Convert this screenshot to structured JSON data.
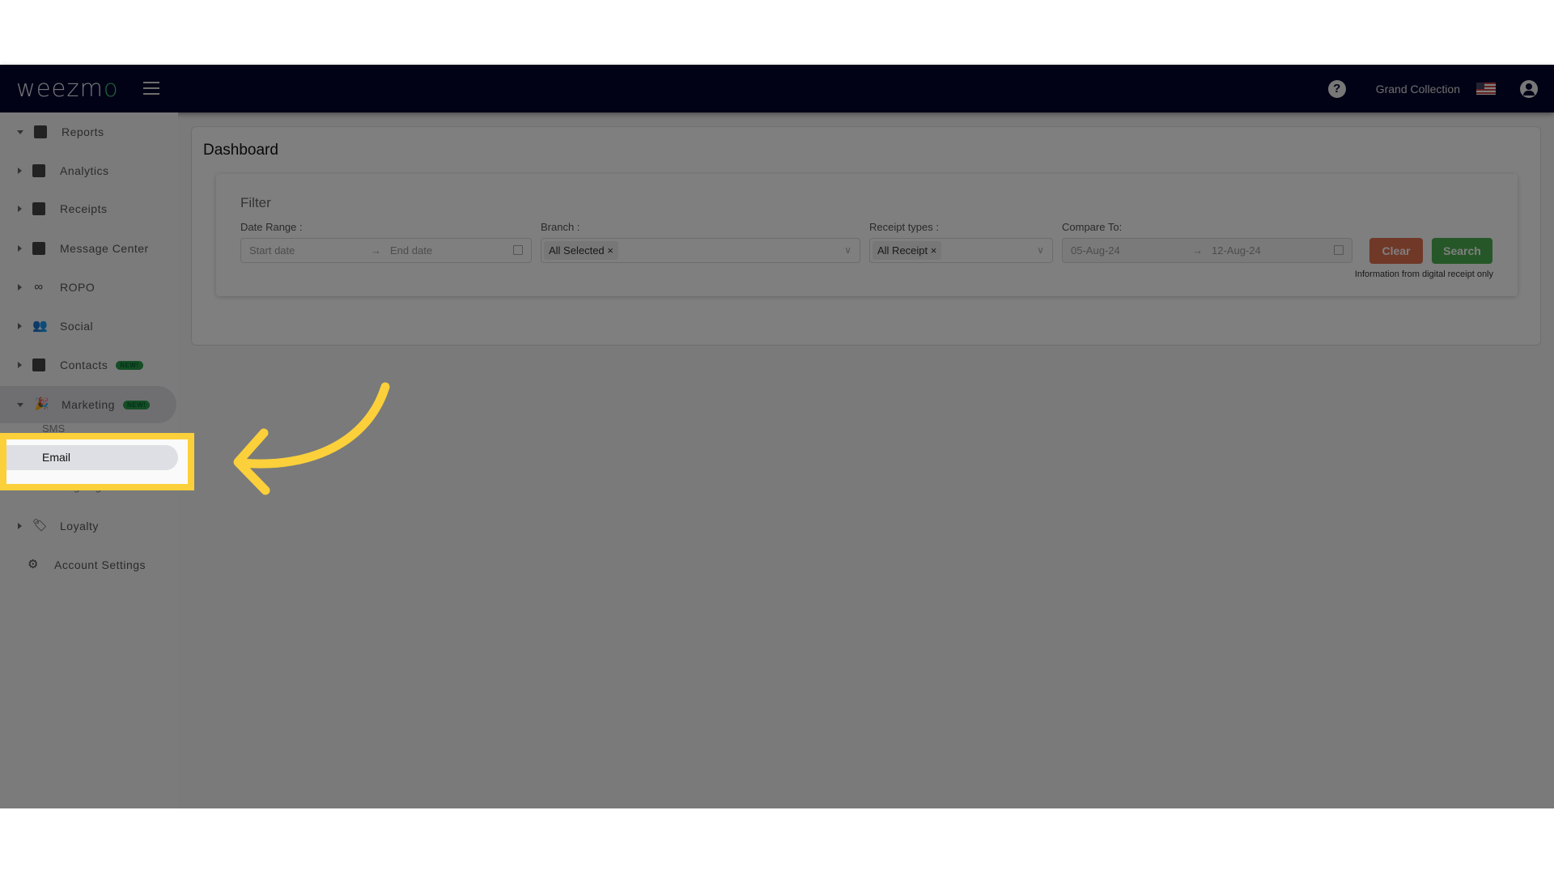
{
  "header": {
    "logo": "weezmo",
    "account": "Grand Collection",
    "icons": [
      "menu-icon",
      "help-icon",
      "us-flag-icon",
      "user-icon"
    ]
  },
  "sidebar": {
    "items": [
      {
        "label": "Reports",
        "icon": "dashboard-icon",
        "expanded": true
      },
      {
        "label": "Analytics",
        "icon": "chart-icon"
      },
      {
        "label": "Receipts",
        "icon": "receipt-icon"
      },
      {
        "label": "Message Center",
        "icon": "chat-icon"
      },
      {
        "label": "ROPO",
        "icon": "infinity-icon"
      },
      {
        "label": "Social",
        "icon": "people-icon"
      },
      {
        "label": "Contacts",
        "icon": "contacts-icon",
        "badge": "NEW!"
      },
      {
        "label": "Marketing",
        "icon": "party-icon",
        "badge": "NEW!",
        "expanded": true
      },
      {
        "label": "Loyalty",
        "icon": "tag-icon"
      },
      {
        "label": "Account Settings",
        "icon": "gear-icon"
      }
    ],
    "marketing_sub": [
      "SMS",
      "Email",
      "Landing Pages"
    ]
  },
  "main": {
    "title": "Dashboard",
    "filter": {
      "title": "Filter",
      "date_range": {
        "label": "Date Range :",
        "start_placeholder": "Start date",
        "end_placeholder": "End date"
      },
      "branch": {
        "label": "Branch :",
        "value": "All Selected"
      },
      "receipt_types": {
        "label": "Receipt types :",
        "value": "All Receipt"
      },
      "compare_to": {
        "label": "Compare To:",
        "start": "05-Aug-24",
        "end": "12-Aug-24"
      },
      "clear_label": "Clear",
      "search_label": "Search",
      "info": "Information from digital receipt only"
    }
  },
  "colors": {
    "header": "#04042e",
    "clear": "#e0704f",
    "search": "#4caf50",
    "highlight": "#fbd03a"
  }
}
